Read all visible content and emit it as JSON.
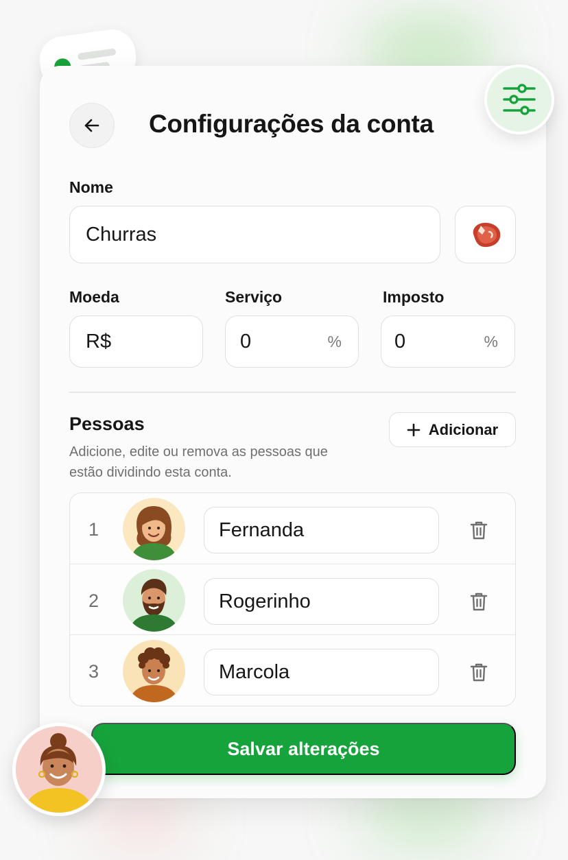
{
  "header": {
    "title": "Configurações da conta"
  },
  "icons": {
    "back": "arrow-left-icon",
    "settings": "sliders-icon",
    "account_emoji": "steak-icon",
    "add": "plus-icon",
    "delete": "trash-icon"
  },
  "form": {
    "name": {
      "label": "Nome",
      "value": "Churras"
    },
    "currency": {
      "label": "Moeda",
      "value": "R$"
    },
    "service": {
      "label": "Serviço",
      "value": "0",
      "unit": "%"
    },
    "tax": {
      "label": "Imposto",
      "value": "0",
      "unit": "%"
    }
  },
  "people": {
    "title": "Pessoas",
    "description": "Adicione, edite ou remova as pessoas que estão dividindo esta conta.",
    "add_label": "Adicionar",
    "items": [
      {
        "number": "1",
        "name": "Fernanda"
      },
      {
        "number": "2",
        "name": "Rogerinho"
      },
      {
        "number": "3",
        "name": "Marcola"
      }
    ]
  },
  "save_button": "Salvar alterações",
  "colors": {
    "accent": "#17a33c",
    "accent_light": "#e5f4e4",
    "text": "#161616",
    "muted": "#6f6f6f",
    "border": "#dedfde"
  }
}
